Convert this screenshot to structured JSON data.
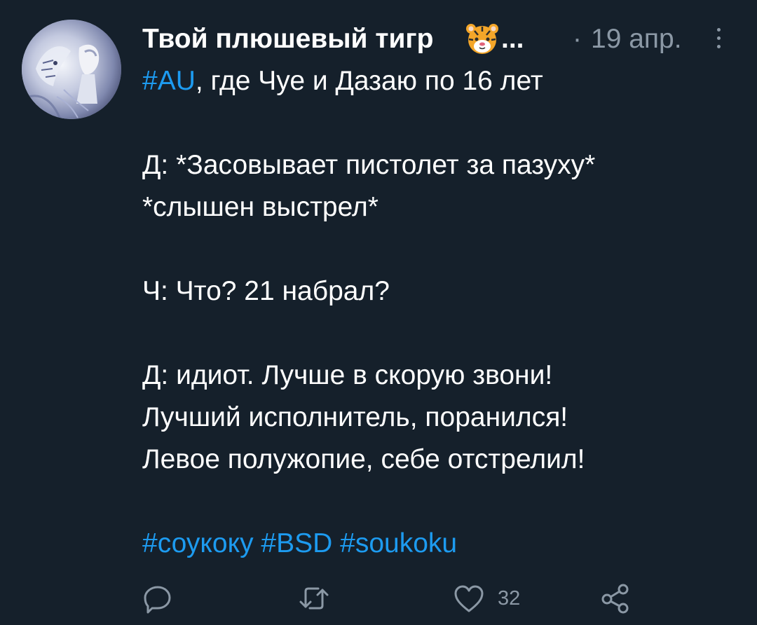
{
  "tweet": {
    "display_name": "Твой плюшевый тигр",
    "name_emoji": "tiger-face",
    "truncation": "...",
    "separator": "·",
    "date": "19 апр.",
    "lines": {
      "l1_hashtag": "#AU",
      "l1_text": ", где Чуе и Дазаю по 16 лет",
      "l2": "Д: *Засовывает пистолет за пазуху*",
      "l3": "*слышен выстрел*",
      "l4": "Ч: Что? 21 набрал?",
      "l5": "Д: идиот. Лучше в скорую звони!",
      "l6": "Лучший исполнитель, поранился!",
      "l7": "Левое полужопие, себе отстрелил!"
    },
    "hashtags": [
      "#соукоку",
      "#BSD",
      "#soukoku"
    ]
  },
  "actions": {
    "reply_icon": "reply-icon",
    "retweet_icon": "retweet-icon",
    "like_icon": "heart-icon",
    "like_count": "32",
    "share_icon": "share-icon"
  },
  "colors": {
    "background": "#15202b",
    "text": "#ffffff",
    "secondary": "#8b98a5",
    "link": "#1d9bf0"
  }
}
